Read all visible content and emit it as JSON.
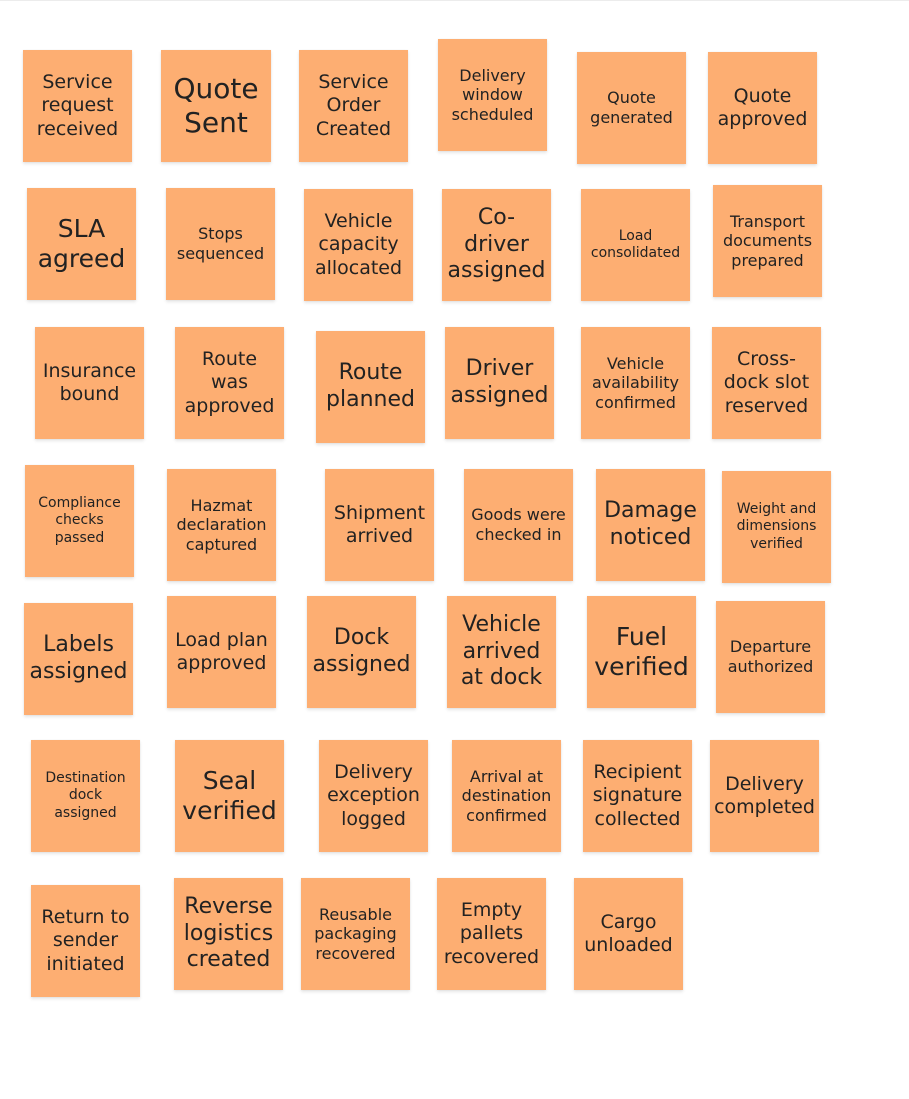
{
  "board": {
    "note_color": "#fdae72",
    "text_color": "#222222",
    "notes": [
      {
        "text": "Service request received"
      },
      {
        "text": "Quote Sent"
      },
      {
        "text": "Service Order Created"
      },
      {
        "text": "Delivery window scheduled"
      },
      {
        "text": "Quote generated"
      },
      {
        "text": "Quote approved"
      },
      {
        "text": "SLA agreed"
      },
      {
        "text": "Stops sequenced"
      },
      {
        "text": "Vehicle capacity allocated"
      },
      {
        "text": "Co-driver assigned"
      },
      {
        "text": "Load consolidated"
      },
      {
        "text": "Transport documents prepared"
      },
      {
        "text": "Insurance bound"
      },
      {
        "text": "Route was approved"
      },
      {
        "text": "Route planned"
      },
      {
        "text": "Driver assigned"
      },
      {
        "text": "Vehicle availability confirmed"
      },
      {
        "text": "Cross-dock slot reserved"
      },
      {
        "text": "Compliance checks passed"
      },
      {
        "text": "Hazmat declaration captured"
      },
      {
        "text": "Shipment arrived"
      },
      {
        "text": "Goods were checked in"
      },
      {
        "text": "Damage noticed"
      },
      {
        "text": "Weight and dimensions verified"
      },
      {
        "text": "Labels assigned"
      },
      {
        "text": "Load plan approved"
      },
      {
        "text": "Dock assigned"
      },
      {
        "text": "Vehicle arrived at dock"
      },
      {
        "text": "Fuel verified"
      },
      {
        "text": "Departure authorized"
      },
      {
        "text": "Destination dock assigned"
      },
      {
        "text": "Seal verified"
      },
      {
        "text": "Delivery exception logged"
      },
      {
        "text": "Arrival at destination confirmed"
      },
      {
        "text": "Recipient signature collected"
      },
      {
        "text": "Delivery completed"
      },
      {
        "text": "Return to sender initiated"
      },
      {
        "text": "Reverse logistics created"
      },
      {
        "text": "Reusable packaging recovered"
      },
      {
        "text": "Empty pallets recovered"
      },
      {
        "text": "Cargo unloaded"
      }
    ]
  }
}
